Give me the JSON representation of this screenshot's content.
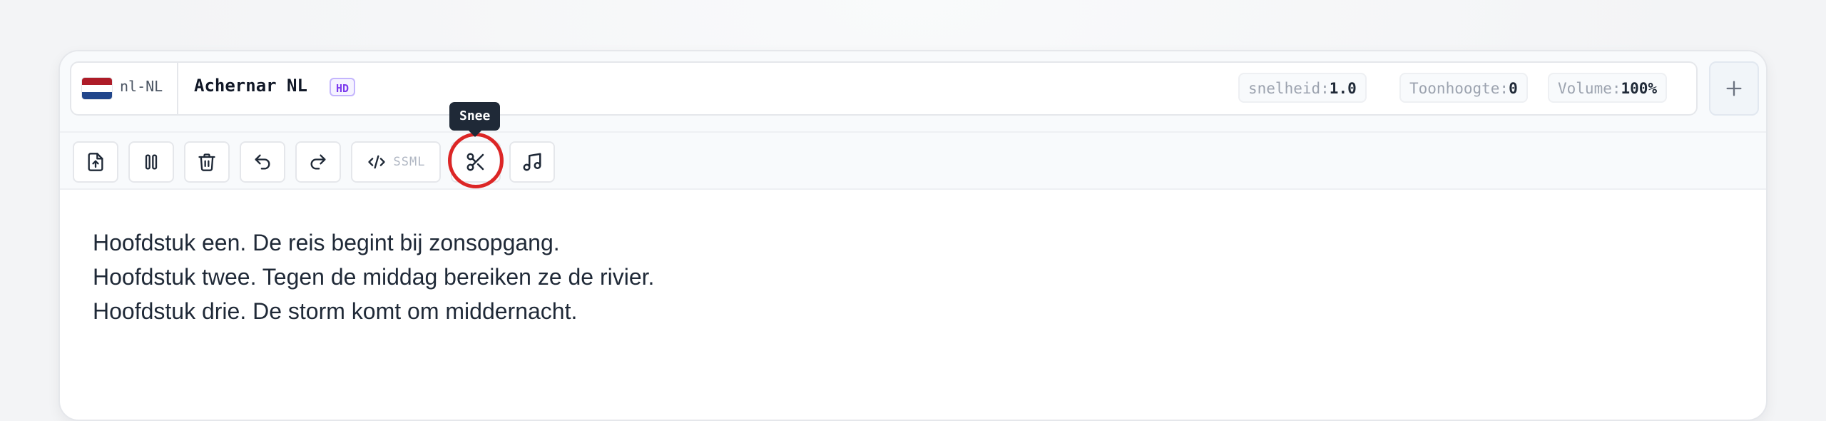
{
  "voice": {
    "language_code": "nl-NL",
    "name": "Achernar NL",
    "badge": "HD",
    "flag_colors": [
      "#ae1c28",
      "#ffffff",
      "#21468b"
    ]
  },
  "params": {
    "speed": {
      "label": "snelheid:",
      "value": "1.0"
    },
    "pitch": {
      "label": "Toonhoogte:",
      "value": "0"
    },
    "volume": {
      "label": "Volume:",
      "value": "100%"
    }
  },
  "add_button": {
    "icon": "plus-icon"
  },
  "toolbar": {
    "buttons": [
      {
        "name": "upload-file-button",
        "icon": "file-upload-icon"
      },
      {
        "name": "pause-button",
        "icon": "pause-icon"
      },
      {
        "name": "delete-button",
        "icon": "trash-icon"
      },
      {
        "name": "undo-button",
        "icon": "undo-icon"
      },
      {
        "name": "redo-button",
        "icon": "redo-icon"
      },
      {
        "name": "ssml-button",
        "icon": "code-icon",
        "label": "SSML"
      },
      {
        "name": "split-button",
        "icon": "scissors-icon"
      },
      {
        "name": "music-button",
        "icon": "music-note-icon"
      }
    ],
    "ssml_label": "SSML",
    "tooltip": "Snee"
  },
  "colors": {
    "highlight": "#dc2626",
    "badge_accent": "#7c3aed"
  },
  "editor": {
    "lines": [
      "Hoofdstuk een. De reis begint bij zonsopgang.",
      "Hoofdstuk twee. Tegen de middag bereiken ze de rivier.",
      "Hoofdstuk drie. De storm komt om middernacht."
    ]
  }
}
